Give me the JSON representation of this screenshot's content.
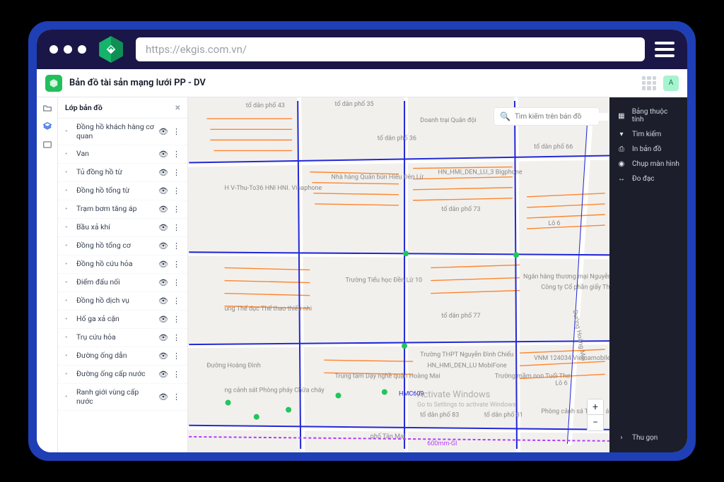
{
  "chrome": {
    "url": "https://ekgis.com.vn/"
  },
  "header": {
    "title": "Bản đồ tài sản mạng lưới PP - DV",
    "avatar_initial": "A"
  },
  "layer_panel": {
    "title": "Lớp bản đồ",
    "items": [
      {
        "label": "Đồng hồ khách hàng cơ quan"
      },
      {
        "label": "Van"
      },
      {
        "label": "Tủ đồng hồ từ"
      },
      {
        "label": "Đồng hồ tổng từ"
      },
      {
        "label": "Trạm bơm tăng áp"
      },
      {
        "label": "Bầu xả khí"
      },
      {
        "label": "Đồng hồ tổng cơ"
      },
      {
        "label": "Đồng hồ cứu hỏa"
      },
      {
        "label": "Điểm đấu nối"
      },
      {
        "label": "Đồng hồ dịch vụ"
      },
      {
        "label": "Hố ga xả cặn"
      },
      {
        "label": "Trụ cứu hỏa"
      },
      {
        "label": "Đường ống dẫn"
      },
      {
        "label": "Đường ống cấp nước"
      },
      {
        "label": "Ranh giới vùng cấp nước"
      }
    ]
  },
  "right_panel": {
    "items": [
      {
        "icon": "table",
        "label": "Bảng thuộc tính"
      },
      {
        "icon": "filter",
        "label": "Tìm kiếm"
      },
      {
        "icon": "print",
        "label": "In bản đồ"
      },
      {
        "icon": "camera",
        "label": "Chụp màn hình"
      },
      {
        "icon": "ruler",
        "label": "Đo đạc"
      }
    ],
    "collapse": "Thu gọn"
  },
  "map": {
    "search_placeholder": "Tìm kiếm trên bản đồ",
    "labels": [
      "tổ dân phố 43",
      "tổ dân phố 35",
      "tổ dân phố 36",
      "tổ dân phố 66",
      "tổ dân phố 73",
      "Lô 6",
      "tổ dân phố 77",
      "tổ dân phố 83",
      "tổ dân phố 81",
      "phố Tân Mai",
      "Đường Hoàng Mai",
      "Lô 6",
      "Doanh trại Quân đội",
      "Trường Tiểu học Đền Lừ 10",
      "Trung tâm Dạy nghề quận Hoàng Mai",
      "Trường THPT Nguyễn Đình Chiểu",
      "Trường mầm non Tuổi Thơ",
      "VNM 124034 Vietnamobile",
      "Ngân hàng thương mại Nguyễn Hương Bình",
      "Công ty Cổ phần giấy Thăng Long",
      "Nhà hàng Quán bún Hiếu Đèn Lừ",
      "HN_HMI_DEN_LU_3 Bigphone",
      "HN_HMI_DEN_LU MobiFone",
      "H V-Thu-To36 HNI HNI. Vinaphone",
      "ung Thể dục Thể thao thiếu nhi",
      "ng cảnh sát Phòng pháy Chữa cháy",
      "Phòng cảnh sá T hành án hình sự Hỗ trợ tư pháp",
      "Đường Hoàng Đình",
      "600mm-GI",
      "HMC609"
    ]
  },
  "watermark": {
    "title": "Activate Windows",
    "sub": "Go to Settings to activate Windows."
  }
}
